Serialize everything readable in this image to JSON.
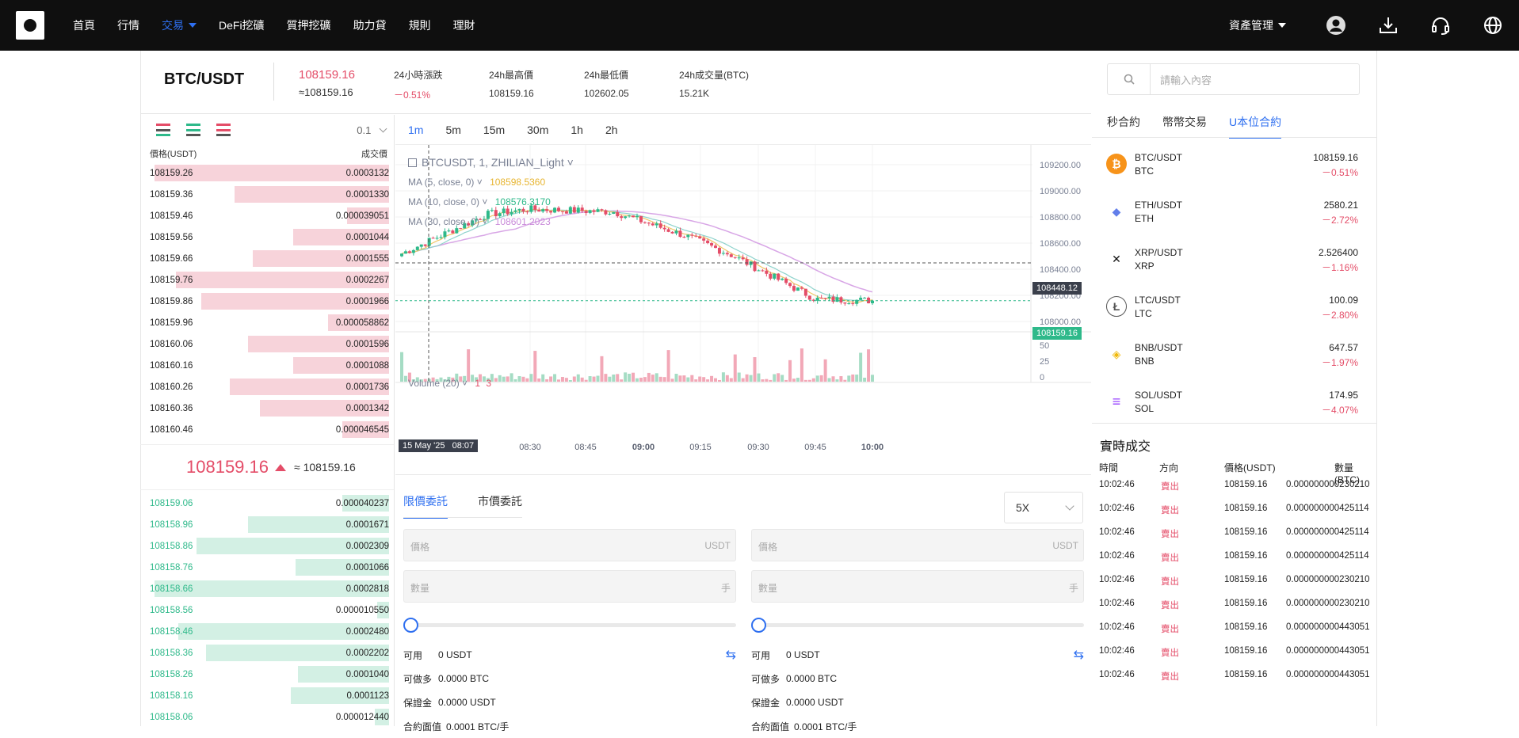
{
  "nav": {
    "items": [
      "首頁",
      "行情",
      "交易",
      "DeFi挖礦",
      "質押挖礦",
      "助力貸",
      "規則",
      "理財"
    ],
    "active_index": 2,
    "asset_label": "資產管理"
  },
  "ticker": {
    "pair": "BTC/USDT",
    "last_price": "108159.16",
    "last_price_fiat": "≈108159.16",
    "change_label": "24小時漲跌",
    "change_value": "－0.51%",
    "high_label": "24h最高價",
    "high_value": "108159.16",
    "low_label": "24h最低價",
    "low_value": "102602.05",
    "vol_label": "24h成交量(BTC)",
    "vol_value": "15.21K"
  },
  "orderbook": {
    "precision": "0.1",
    "price_header": "價格(USDT)",
    "qty_header": "成交價",
    "asks": [
      {
        "price": "108159.26",
        "qty": "0.0003132",
        "depth": 1.0
      },
      {
        "price": "108159.36",
        "qty": "0.0001330",
        "depth": 0.66
      },
      {
        "price": "108159.46",
        "qty": "0.000039051",
        "depth": 0.18
      },
      {
        "price": "108159.56",
        "qty": "0.0001044",
        "depth": 0.41
      },
      {
        "price": "108159.66",
        "qty": "0.0001555",
        "depth": 0.58
      },
      {
        "price": "108159.76",
        "qty": "0.0002267",
        "depth": 0.91
      },
      {
        "price": "108159.86",
        "qty": "0.0001966",
        "depth": 0.8
      },
      {
        "price": "108159.96",
        "qty": "0.000058862",
        "depth": 0.26
      },
      {
        "price": "108160.06",
        "qty": "0.0001596",
        "depth": 0.6
      },
      {
        "price": "108160.16",
        "qty": "0.0001088",
        "depth": 0.41
      },
      {
        "price": "108160.26",
        "qty": "0.0001736",
        "depth": 0.68
      },
      {
        "price": "108160.36",
        "qty": "0.0001342",
        "depth": 0.55
      },
      {
        "price": "108160.46",
        "qty": "0.000046545",
        "depth": 0.2
      }
    ],
    "mid_price": "108159.16",
    "mid_approx": "≈ 108159.16",
    "bids": [
      {
        "price": "108159.06",
        "qty": "0.000040237",
        "depth": 0.2
      },
      {
        "price": "108158.96",
        "qty": "0.0001671",
        "depth": 0.6
      },
      {
        "price": "108158.86",
        "qty": "0.0002309",
        "depth": 0.82
      },
      {
        "price": "108158.76",
        "qty": "0.0001066",
        "depth": 0.4
      },
      {
        "price": "108158.66",
        "qty": "0.0002818",
        "depth": 1.0
      },
      {
        "price": "108158.56",
        "qty": "0.000010550",
        "depth": 0.05
      },
      {
        "price": "108158.46",
        "qty": "0.0002480",
        "depth": 0.9
      },
      {
        "price": "108158.36",
        "qty": "0.0002202",
        "depth": 0.78
      },
      {
        "price": "108158.26",
        "qty": "0.0001040",
        "depth": 0.39
      },
      {
        "price": "108158.16",
        "qty": "0.0001123",
        "depth": 0.42
      },
      {
        "price": "108158.06",
        "qty": "0.000012440",
        "depth": 0.06
      }
    ]
  },
  "chart": {
    "intervals": [
      "1m",
      "5m",
      "15m",
      "30m",
      "1h",
      "2h"
    ],
    "active_interval": 0,
    "symbol_label": "BTCUSDT, 1, ZHILIAN_Light",
    "ma": [
      {
        "label": "MA (5, close, 0)",
        "value": "108598.5360",
        "color": "#e7b531"
      },
      {
        "label": "MA (10, close, 0)",
        "value": "108576.3170",
        "color": "#6fc6bd"
      },
      {
        "label": "MA (30, close, 0)",
        "value": "108601.2023",
        "color": "#d8a6e6"
      }
    ],
    "price_ticks": [
      "109200.00",
      "109000.00",
      "108800.00",
      "108600.00",
      "108400.00",
      "108200.00",
      "108000.00"
    ],
    "crosshair_price": "108448.12",
    "current_price": "108159.16",
    "volume_label": "Volume (20)",
    "volume_vals": [
      "1",
      "3"
    ],
    "volume_ticks": [
      "50",
      "25",
      "0"
    ],
    "time_ticks": [
      "08:30",
      "08:45",
      "09:00",
      "09:15",
      "09:30",
      "09:45",
      "10:00"
    ],
    "crosshair_time": "15 May '25   08:07",
    "colors": {
      "up": "#2eb98a",
      "down": "#e44d68",
      "up_vol": "#a5dcc4",
      "down_vol": "#f2a8b7"
    }
  },
  "chart_data": {
    "type": "candlestick",
    "title": "BTCUSDT, 1, ZHILIAN_Light",
    "x_range": [
      "08:07",
      "10:07"
    ],
    "ylim": [
      108000,
      109200
    ],
    "grid": true,
    "close_start": 108520,
    "close_end": 108159.16,
    "peak_close": 108860
  },
  "orderform": {
    "tabs": [
      "限價委託",
      "市價委託"
    ],
    "active_tab": 0,
    "leverage": "5X",
    "buy": {
      "price_ph": "價格",
      "price_unit": "USDT",
      "qty_ph": "數量",
      "qty_unit": "手",
      "avail_label": "可用",
      "avail": "0 USDT",
      "long_label": "可做多",
      "long": "0.0000 BTC",
      "margin_label": "保證金",
      "margin": "0.0000 USDT",
      "face_label": "合約面值",
      "face": "0.0001 BTC/手"
    },
    "sell": {
      "price_ph": "價格",
      "price_unit": "USDT",
      "qty_ph": "數量",
      "qty_unit": "手",
      "avail_label": "可用",
      "avail": "0 USDT",
      "long_label": "可做多",
      "long": "0.0000 BTC",
      "margin_label": "保證金",
      "margin": "0.0000 USDT",
      "face_label": "合約面值",
      "face": "0.0001 BTC/手"
    }
  },
  "right": {
    "search_ph": "請輸入內容",
    "tabs": [
      "秒合約",
      "幣幣交易",
      "U本位合約"
    ],
    "active_tab": 2,
    "markets": [
      {
        "pair": "BTC/USDT",
        "base": "BTC",
        "price": "108159.16",
        "change": "－0.51%",
        "icon": "bitcoin-icon",
        "color": "#f7931a",
        "glyph": "₿"
      },
      {
        "pair": "ETH/USDT",
        "base": "ETH",
        "price": "2580.21",
        "change": "－2.72%",
        "icon": "ethereum-icon",
        "color": "#ffffff",
        "glyph": "◆"
      },
      {
        "pair": "XRP/USDT",
        "base": "XRP",
        "price": "2.526400",
        "change": "－1.16%",
        "icon": "xrp-icon",
        "color": "#ffffff",
        "glyph": "✕"
      },
      {
        "pair": "LTC/USDT",
        "base": "LTC",
        "price": "100.09",
        "change": "－2.80%",
        "icon": "litecoin-icon",
        "color": "#ffffff",
        "glyph": "Ł"
      },
      {
        "pair": "BNB/USDT",
        "base": "BNB",
        "price": "647.57",
        "change": "－1.97%",
        "icon": "bnb-icon",
        "color": "#ffffff",
        "glyph": "◈"
      },
      {
        "pair": "SOL/USDT",
        "base": "SOL",
        "price": "174.95",
        "change": "－4.07%",
        "icon": "solana-icon",
        "color": "#ffffff",
        "glyph": "≡"
      }
    ],
    "trades_title": "實時成交",
    "trades_headers": [
      "時間",
      "方向",
      "價格(USDT)",
      "數量(BTC)"
    ],
    "trades": [
      {
        "time": "10:02:46",
        "side": "賣出",
        "price": "108159.16",
        "qty": "0.000000000230210"
      },
      {
        "time": "10:02:46",
        "side": "賣出",
        "price": "108159.16",
        "qty": "0.000000000425114"
      },
      {
        "time": "10:02:46",
        "side": "賣出",
        "price": "108159.16",
        "qty": "0.000000000425114"
      },
      {
        "time": "10:02:46",
        "side": "賣出",
        "price": "108159.16",
        "qty": "0.000000000425114"
      },
      {
        "time": "10:02:46",
        "side": "賣出",
        "price": "108159.16",
        "qty": "0.000000000230210"
      },
      {
        "time": "10:02:46",
        "side": "賣出",
        "price": "108159.16",
        "qty": "0.000000000230210"
      },
      {
        "time": "10:02:46",
        "side": "賣出",
        "price": "108159.16",
        "qty": "0.000000000443051"
      },
      {
        "time": "10:02:46",
        "side": "賣出",
        "price": "108159.16",
        "qty": "0.000000000443051"
      },
      {
        "time": "10:02:46",
        "side": "賣出",
        "price": "108159.16",
        "qty": "0.000000000443051"
      }
    ]
  }
}
